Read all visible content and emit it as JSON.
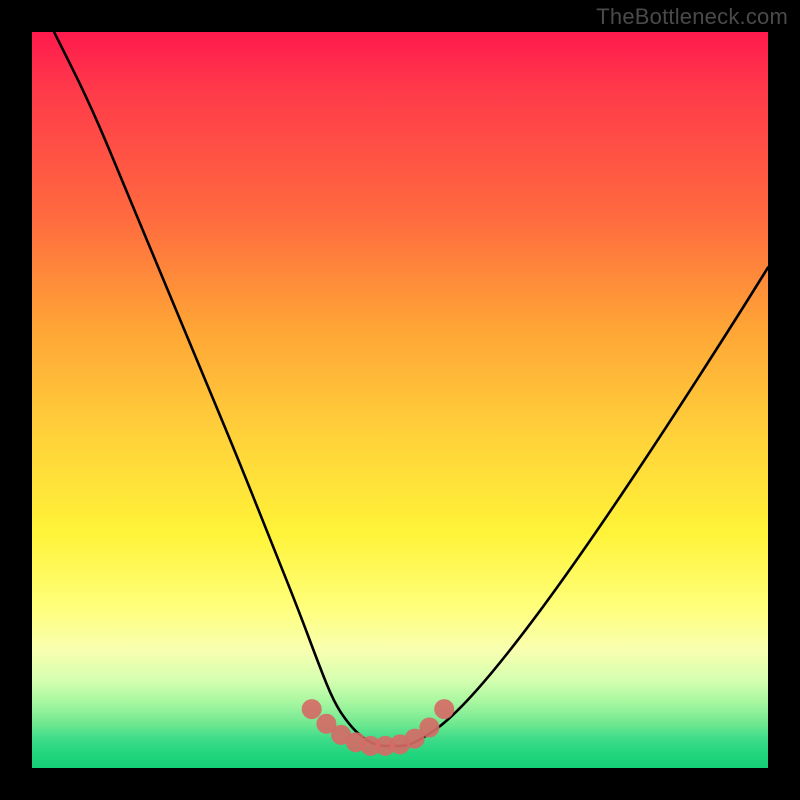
{
  "watermark": "TheBottleneck.com",
  "chart_data": {
    "type": "line",
    "title": "",
    "xlabel": "",
    "ylabel": "",
    "xrange": [
      0,
      100
    ],
    "yrange": [
      0,
      100
    ],
    "grid": false,
    "legend": false,
    "series": [
      {
        "name": "bottleneck-curve",
        "stroke": "#000000",
        "x": [
          3,
          8,
          13,
          18,
          23,
          28,
          32,
          36,
          39,
          41,
          43,
          45,
          47,
          49,
          51,
          53,
          56,
          60,
          65,
          71,
          78,
          86,
          95,
          100
        ],
        "y": [
          100,
          90,
          78,
          66,
          54,
          42,
          32,
          22,
          14,
          9,
          6,
          4,
          3,
          3,
          3,
          4,
          6,
          10,
          16,
          24,
          34,
          46,
          60,
          68
        ]
      }
    ],
    "markers": {
      "name": "highlight-points",
      "color": "#d56b66",
      "x": [
        38,
        40,
        42,
        44,
        46,
        48,
        50,
        52,
        54,
        56
      ],
      "y": [
        8,
        6,
        4.5,
        3.5,
        3,
        3,
        3.2,
        4,
        5.5,
        8
      ]
    },
    "gradient_stops": [
      {
        "pos": 0.0,
        "color": "#ff1a4d"
      },
      {
        "pos": 0.25,
        "color": "#ff6a3f"
      },
      {
        "pos": 0.55,
        "color": "#ffd23a"
      },
      {
        "pos": 0.78,
        "color": "#ffff7a"
      },
      {
        "pos": 0.9,
        "color": "#a8f7a0"
      },
      {
        "pos": 1.0,
        "color": "#14cf76"
      }
    ]
  }
}
